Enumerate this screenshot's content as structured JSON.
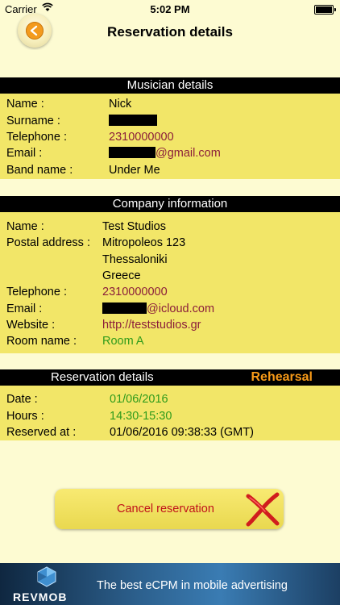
{
  "status_bar": {
    "carrier": "Carrier",
    "time": "5:02 PM"
  },
  "nav": {
    "title": "Reservation details"
  },
  "musician": {
    "header": "Musician details",
    "name_label": "Name :",
    "name": "Nick",
    "surname_label": "Surname :",
    "telephone_label": "Telephone :",
    "telephone": "2310000000",
    "email_label": "Email :",
    "email_suffix": "@gmail.com",
    "band_label": "Band name :",
    "band": "Under Me"
  },
  "company": {
    "header": "Company information",
    "name_label": "Name :",
    "name": "Test Studios",
    "postal_label": "Postal address :",
    "address_line1": "Mitropoleos 123",
    "address_line2": "Thessaloniki",
    "address_line3": "Greece",
    "telephone_label": "Telephone :",
    "telephone": "2310000000",
    "email_label": "Email :",
    "email_suffix": "@icloud.com",
    "website_label": "Website :",
    "website": "http://teststudios.gr",
    "room_label": "Room name :",
    "room": "Room A"
  },
  "reservation": {
    "header": "Reservation details",
    "type": "Rehearsal",
    "date_label": "Date :",
    "date": "01/06/2016",
    "hours_label": "Hours :",
    "hours": "14:30-15:30",
    "reserved_label": "Reserved at :",
    "reserved": "01/06/2016 09:38:33 (GMT)"
  },
  "actions": {
    "cancel_label": "Cancel reservation"
  },
  "ad": {
    "brand": "REVMOB",
    "slogan": "The best eCPM in mobile advertising"
  },
  "colors": {
    "panel": "#f2e668",
    "background": "#fdfbd2",
    "maroon": "#8b1e3a",
    "green": "#2f9b1b",
    "accent": "#f79a18",
    "cancel": "#c0111a"
  }
}
